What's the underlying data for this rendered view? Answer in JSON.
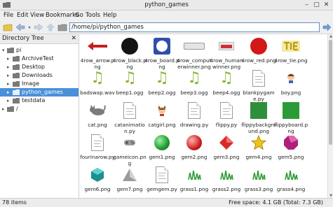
{
  "window": {
    "title": "python_games"
  },
  "menu": [
    "File",
    "Edit",
    "View",
    "Bookmarks",
    "Go",
    "Tools",
    "Help"
  ],
  "toolbar": {
    "path": "/home/pi/python_games"
  },
  "sidebar": {
    "header": "Directory Tree",
    "close_glyph": "✕",
    "items": [
      {
        "label": "pi",
        "arrow": "▾"
      },
      {
        "label": "ArchiveTest",
        "arrow": "▸"
      },
      {
        "label": "Desktop",
        "arrow": "▸"
      },
      {
        "label": "Downloads",
        "arrow": "▸"
      },
      {
        "label": "Image",
        "arrow": "▸"
      },
      {
        "label": "python_games",
        "arrow": "▸"
      },
      {
        "label": "testdata",
        "arrow": "▸"
      },
      {
        "label": "/",
        "arrow": "▸"
      }
    ]
  },
  "files": [
    {
      "name": "4row_arrow.png",
      "icon": "red-arrow-icon"
    },
    {
      "name": "4row_black.png",
      "icon": "black-circle-icon"
    },
    {
      "name": "4row_board.png",
      "icon": "board-icon"
    },
    {
      "name": "4row_computerwinner.png",
      "icon": "banner-icon"
    },
    {
      "name": "4row_humanwinner.png",
      "icon": "banner-red-icon"
    },
    {
      "name": "4row_red.png",
      "icon": "red-circle-icon"
    },
    {
      "name": "4row_tie.png",
      "icon": "tie-icon"
    },
    {
      "name": "badswap.wav",
      "icon": "audio-icon"
    },
    {
      "name": "beep1.ogg",
      "icon": "audio-icon"
    },
    {
      "name": "beep2.ogg",
      "icon": "audio-icon"
    },
    {
      "name": "beep3.ogg",
      "icon": "audio-icon"
    },
    {
      "name": "beep4.ogg",
      "icon": "audio-icon"
    },
    {
      "name": "blankpygame.py",
      "icon": "document-icon"
    },
    {
      "name": "boy.png",
      "icon": "boy-icon"
    },
    {
      "name": "cat.png",
      "icon": "cat-icon"
    },
    {
      "name": "catanimation.py",
      "icon": "document-icon"
    },
    {
      "name": "catgirl.png",
      "icon": "catgirl-icon"
    },
    {
      "name": "drawing.py",
      "icon": "document-icon"
    },
    {
      "name": "flippy.py",
      "icon": "document-icon"
    },
    {
      "name": "flippybackground.png",
      "icon": "green-square-icon"
    },
    {
      "name": "flippyboard.png",
      "icon": "green-square-icon"
    },
    {
      "name": "fourinarow.py",
      "icon": "document-icon"
    },
    {
      "name": "gameicon.png",
      "icon": "gameicon-icon"
    },
    {
      "name": "gem1.png",
      "icon": "gem-icon"
    },
    {
      "name": "gem2.png",
      "icon": "gem-icon"
    },
    {
      "name": "gem3.png",
      "icon": "gem-icon"
    },
    {
      "name": "gem4.png",
      "icon": "star-icon"
    },
    {
      "name": "gem5.png",
      "icon": "gem-icon"
    },
    {
      "name": "gem6.png",
      "icon": "gem-icon"
    },
    {
      "name": "gem7.png",
      "icon": "gem-icon"
    },
    {
      "name": "gemgem.py",
      "icon": "document-icon"
    },
    {
      "name": "grass1.png",
      "icon": "grass-icon"
    },
    {
      "name": "grass2.png",
      "icon": "grass-icon"
    },
    {
      "name": "grass3.png",
      "icon": "grass-icon"
    },
    {
      "name": "grass4.png",
      "icon": "grass-icon"
    }
  ],
  "colors": {
    "selection": "#4a90d9",
    "gem1": "#1d9a2c",
    "gem2": "#cf2020",
    "gem3": "#d62b2b",
    "gem5": "#b0207a",
    "gem6": "#1c8f8f",
    "gem7": "#9a9a9a",
    "folder": "#7a7a7a"
  },
  "status": {
    "items": "78 items",
    "free_space": "Free space: 4.1 GB (Total: 7.3 GB)"
  }
}
